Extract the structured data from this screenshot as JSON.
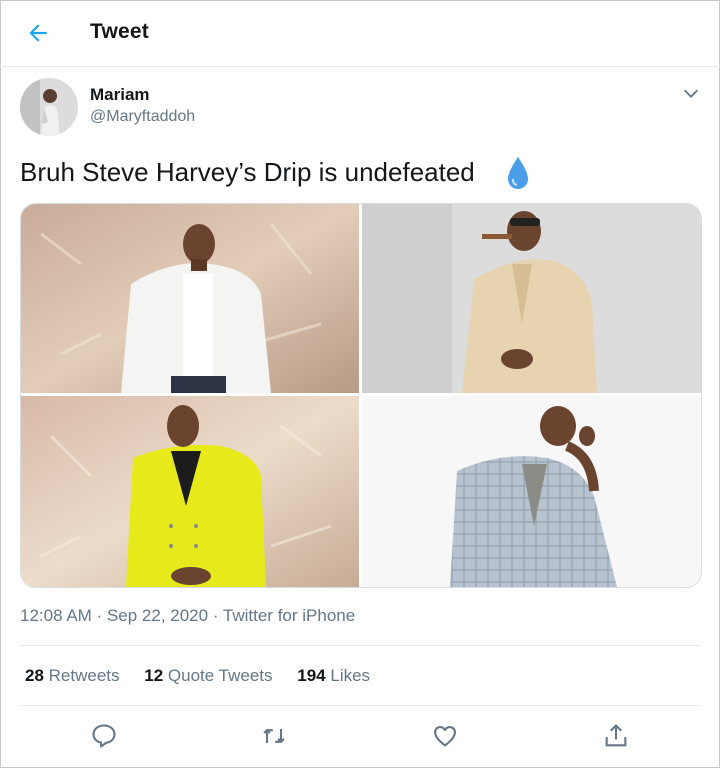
{
  "header": {
    "title": "Tweet"
  },
  "author": {
    "name": "Mariam",
    "handle": "@Maryftaddoh"
  },
  "tweet": {
    "text": "Bruh Steve Harvey’s Drip is undefeated",
    "emoji": "droplet-emoji",
    "images": [
      {
        "name": "photo-white-jacket"
      },
      {
        "name": "photo-cream-suit-cigar"
      },
      {
        "name": "photo-yellow-suit"
      },
      {
        "name": "photo-plaid-suit"
      }
    ]
  },
  "meta": {
    "time": "12:08 AM",
    "sep1": " · ",
    "date": "Sep 22, 2020",
    "sep2": " · ",
    "source": "Twitter for iPhone"
  },
  "stats": {
    "retweets": {
      "count": "28",
      "label": "Retweets"
    },
    "quotes": {
      "count": "12",
      "label": "Quote Tweets"
    },
    "likes": {
      "count": "194",
      "label": "Likes"
    }
  },
  "actions": [
    "reply-icon",
    "retweet-icon",
    "like-icon",
    "share-icon"
  ],
  "colors": {
    "accent": "#1da1f2",
    "secondary_text": "#657786",
    "border": "#e6ecf0"
  }
}
